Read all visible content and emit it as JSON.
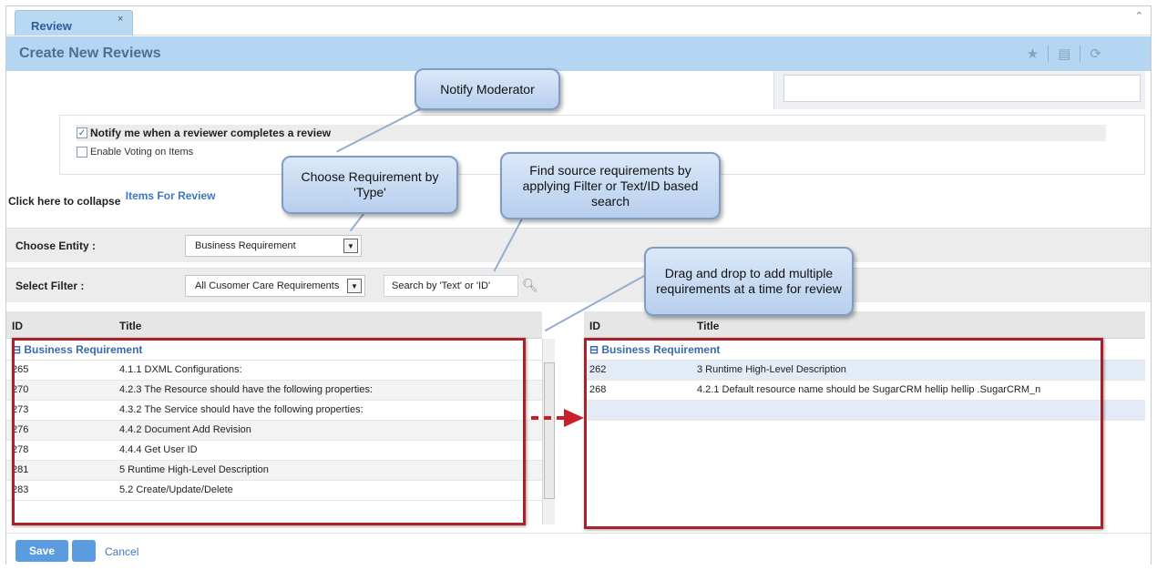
{
  "tab": {
    "label": "Review",
    "close": "×"
  },
  "header": {
    "title": "Create New Reviews",
    "icons": [
      "star-icon",
      "folder-icon",
      "refresh-icon"
    ]
  },
  "notify": {
    "checked_label": "Notify me when a reviewer completes a review",
    "voting_label": "Enable Voting on Items",
    "check_mark": "✓"
  },
  "collapse": {
    "text": "Click here to collapse",
    "link": "Items For Review"
  },
  "entity": {
    "label": "Choose Entity :",
    "value": "Business Requirement"
  },
  "filter": {
    "label": "Select Filter :",
    "value": "All Cusomer Care Requirements",
    "search_placeholder": "Search by 'Text' or 'ID'"
  },
  "left_grid": {
    "columns": {
      "id": "ID",
      "title": "Title"
    },
    "group": "Business Requirement",
    "rows": [
      {
        "id": "265",
        "title": "4.1.1 DXML Configurations:"
      },
      {
        "id": "270",
        "title": "4.2.3 The Resource should have the following properties:"
      },
      {
        "id": "273",
        "title": "4.3.2 The Service should have the following properties:"
      },
      {
        "id": "276",
        "title": "4.4.2 Document Add Revision"
      },
      {
        "id": "278",
        "title": "4.4.4 Get User ID"
      },
      {
        "id": "281",
        "title": "5 Runtime High-Level Description"
      },
      {
        "id": "283",
        "title": "5.2 Create/Update/Delete"
      }
    ]
  },
  "right_grid": {
    "columns": {
      "id": "ID",
      "title": "Title"
    },
    "group": "Business Requirement",
    "rows": [
      {
        "id": "262",
        "title": "3 Runtime High-Level Description"
      },
      {
        "id": "268",
        "title": "4.2.1 Default resource name should be SugarCRM hellip hellip .SugarCRM_n"
      }
    ]
  },
  "callouts": {
    "notify": "Notify Moderator",
    "type": "Choose Requirement by 'Type'",
    "search": "Find source requirements by applying Filter or Text/ID based search",
    "drag": "Drag and drop to add multiple requirements at a time for review"
  },
  "footer": {
    "save": "Save",
    "cancel": "Cancel"
  },
  "colors": {
    "accent": "#5b9be0",
    "header": "#b4d6f3",
    "highlight": "#a8222a"
  }
}
